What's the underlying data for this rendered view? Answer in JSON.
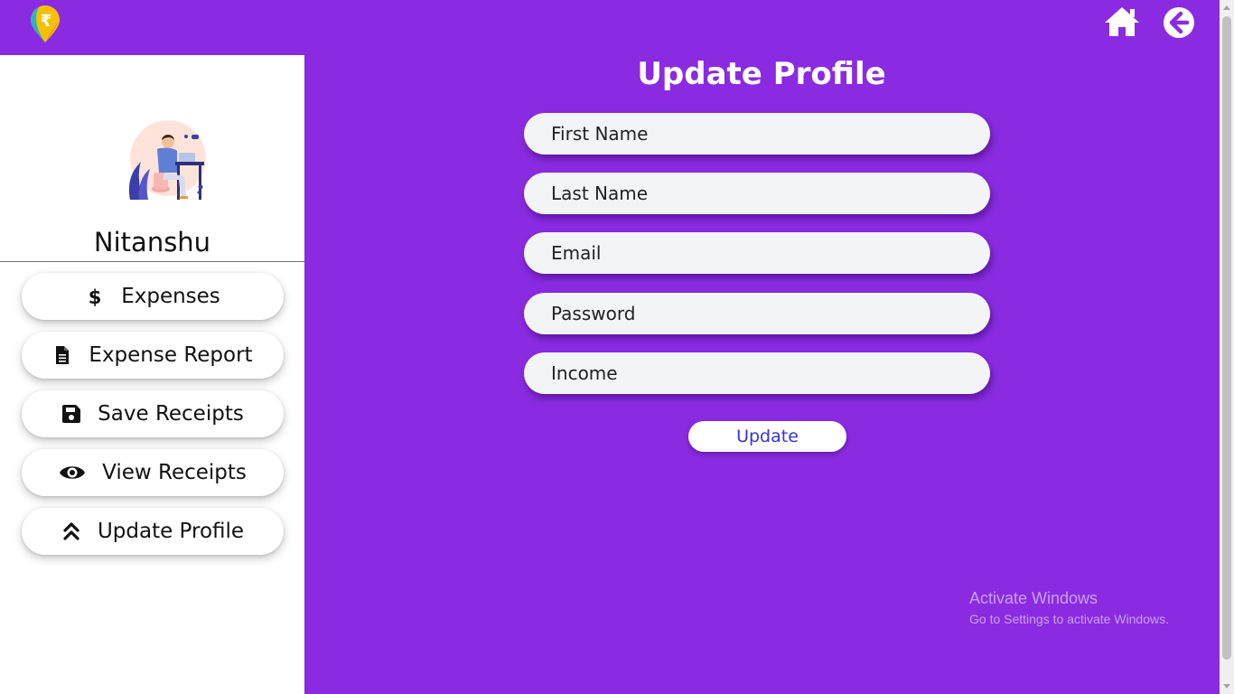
{
  "app": {
    "brand_colors": {
      "primary": "#8a2be2",
      "panel": "#ffffff",
      "field": "#f3f4f6",
      "button_text": "#3333dd"
    }
  },
  "topbar": {
    "logo_icon": "rupee-pin-icon",
    "home_icon": "home-icon",
    "back_icon": "arrow-left-circle-icon"
  },
  "sidebar": {
    "avatar_icon": "person-at-desk-illustration",
    "username": "Nitanshu",
    "items": [
      {
        "label": "Expenses",
        "icon": "dollar-icon"
      },
      {
        "label": "Expense Report",
        "icon": "file-icon"
      },
      {
        "label": "Save Receipts",
        "icon": "floppy-disk-icon"
      },
      {
        "label": "View Receipts",
        "icon": "eye-icon"
      },
      {
        "label": "Update Profile",
        "icon": "double-chevron-up-icon"
      }
    ]
  },
  "form": {
    "title": "Update Profile",
    "fields": {
      "first_name": {
        "placeholder": "First Name",
        "value": ""
      },
      "last_name": {
        "placeholder": "Last Name",
        "value": ""
      },
      "email": {
        "placeholder": "Email",
        "value": ""
      },
      "password": {
        "placeholder": "Password",
        "value": ""
      },
      "income": {
        "placeholder": "Income",
        "value": ""
      }
    },
    "submit_label": "Update"
  },
  "watermark": {
    "title": "Activate Windows",
    "subtitle": "Go to Settings to activate Windows."
  }
}
